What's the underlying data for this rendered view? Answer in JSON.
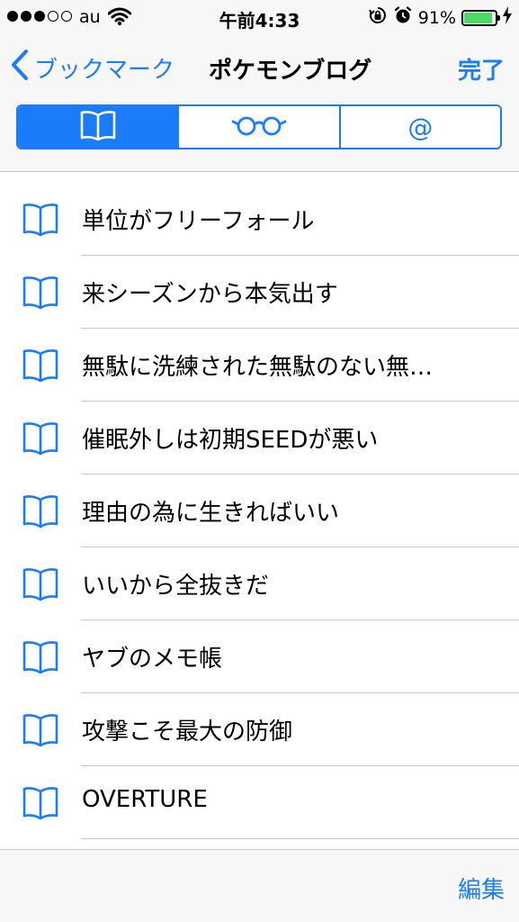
{
  "status_bar": {
    "carrier": "au",
    "time": "午前4:33",
    "battery_percent": "91%",
    "battery_level": 0.91,
    "signal_bars": 3,
    "signal_total": 5
  },
  "nav": {
    "back_label": "ブックマーク",
    "title": "ポケモンブログ",
    "done_label": "完了"
  },
  "segments": [
    {
      "name": "bookmarks",
      "icon": "book-icon",
      "active": true
    },
    {
      "name": "reading-list",
      "icon": "glasses-icon",
      "active": false
    },
    {
      "name": "shared-links",
      "icon": "at-icon",
      "label": "@",
      "active": false
    }
  ],
  "bookmarks": [
    {
      "title": "単位がフリーフォール"
    },
    {
      "title": "来シーズンから本気出す"
    },
    {
      "title": "無駄に洗練された無駄のない無…"
    },
    {
      "title": "催眠外しは初期SEEDが悪い"
    },
    {
      "title": "理由の為に生きればいい"
    },
    {
      "title": "いいから全抜きだ"
    },
    {
      "title": "ヤブのメモ帳"
    },
    {
      "title": "攻撃こそ最大の防御"
    },
    {
      "title": "OVERTURE"
    }
  ],
  "toolbar": {
    "edit_label": "編集"
  },
  "colors": {
    "accent": "#1a7cf9",
    "battery": "#4cd964"
  }
}
